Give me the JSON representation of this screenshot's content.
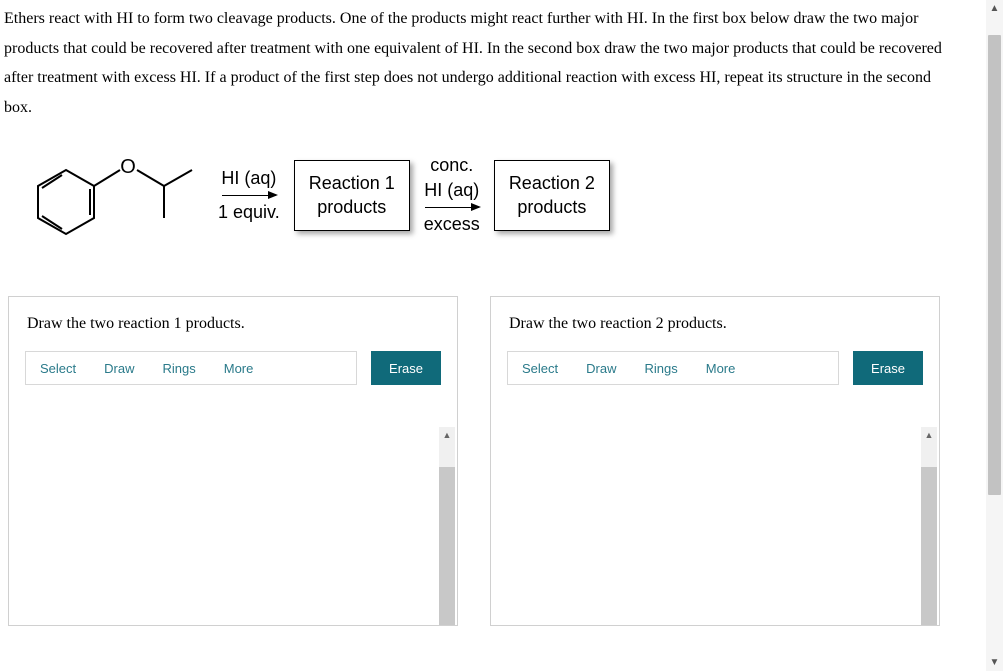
{
  "question": "Ethers react with HI to form two cleavage products. One of the products might react further with HI. In the first box below draw the two major products that could be recovered after treatment with one equivalent of HI. In the second box draw the two major products that could be recovered after treatment with excess HI. If a product of the first step does not undergo additional reaction with excess HI, repeat its structure in the second box.",
  "scheme": {
    "reagent1_top": "HI (aq)",
    "reagent1_bottom": "1 equiv.",
    "box1_line1": "Reaction 1",
    "box1_line2": "products",
    "reagent2_top": "conc.",
    "reagent2_mid": "HI (aq)",
    "reagent2_bottom": "excess",
    "box2_line1": "Reaction 2",
    "box2_line2": "products"
  },
  "draw1": {
    "title": "Draw the two reaction 1 products.",
    "tools": {
      "select": "Select",
      "draw": "Draw",
      "rings": "Rings",
      "more": "More"
    },
    "erase": "Erase"
  },
  "draw2": {
    "title": "Draw the two reaction 2 products.",
    "tools": {
      "select": "Select",
      "draw": "Draw",
      "rings": "Rings",
      "more": "More"
    },
    "erase": "Erase"
  }
}
